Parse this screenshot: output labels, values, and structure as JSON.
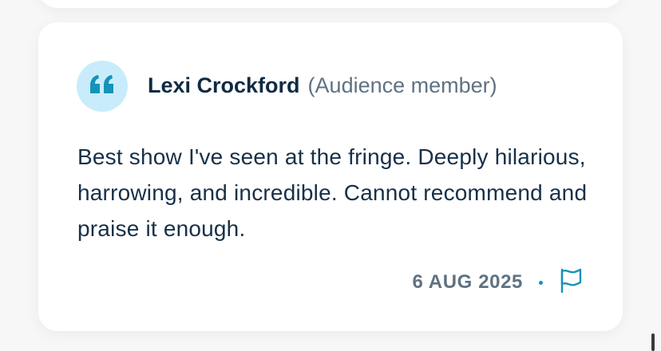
{
  "review": {
    "author_name": "Lexi Crockford",
    "author_role": "(Audience member)",
    "text": "Best show I've seen at the fringe. Deeply hilarious, harrowing, and incredible. Cannot recommend and praise it enough.",
    "date": "6 AUG 2025",
    "icons": {
      "quote": "quote-icon",
      "flag": "flag-icon"
    }
  },
  "colors": {
    "accent": "#1593b8",
    "badge_bg": "#c8ecfb",
    "heading": "#0f2a43",
    "muted": "#5f7283"
  }
}
